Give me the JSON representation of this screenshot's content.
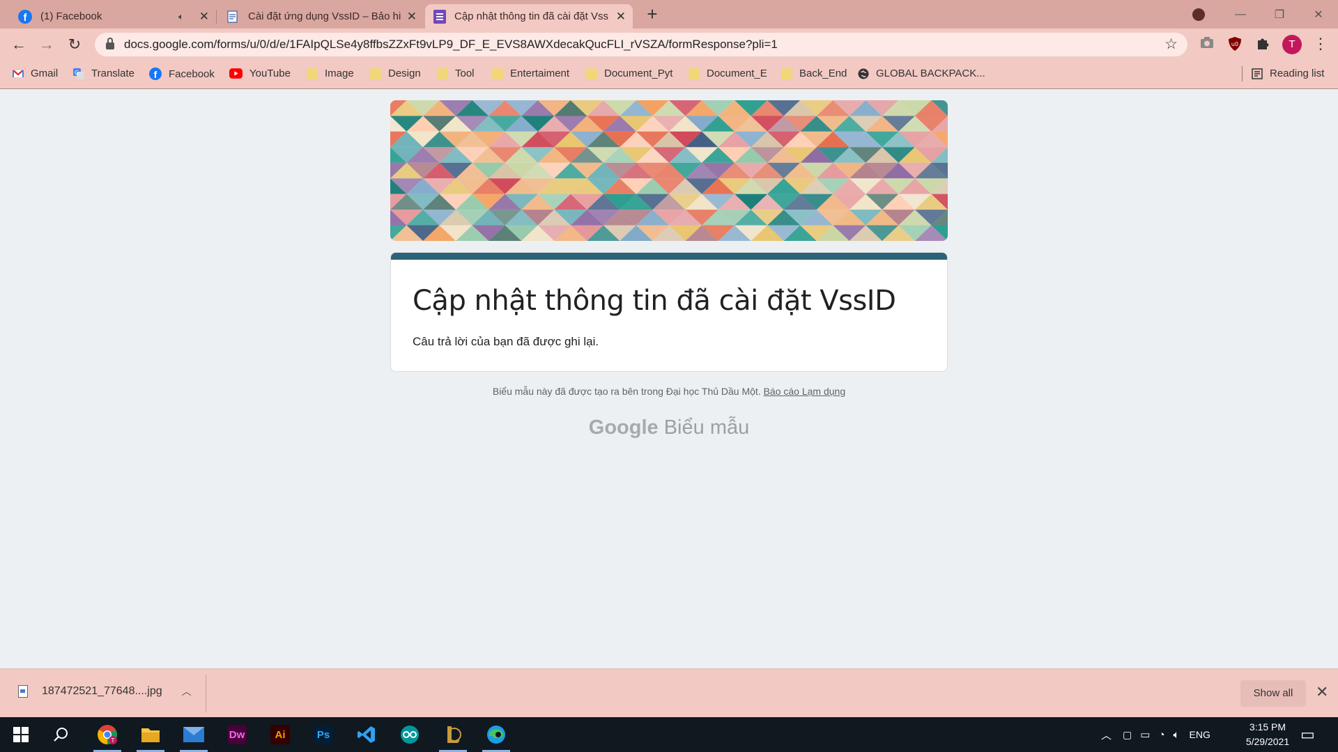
{
  "tabs": [
    {
      "title": "(1) Facebook",
      "icon": "facebook-icon",
      "muted": true
    },
    {
      "title": "Cài đặt ứng dụng VssID – Bảo hiể",
      "icon": "document-icon"
    },
    {
      "title": "Cập nhật thông tin đã cài đặt Vss",
      "icon": "google-forms-icon",
      "active": true
    }
  ],
  "toolbar": {
    "url": "docs.google.com/forms/u/0/d/e/1FAIpQLSe4y8ffbsZZxFt9vLP9_DF_E_EVS8AWXdecakQucFLI_rVSZA/formResponse?pli=1",
    "profile_initial": "T"
  },
  "bookmarks": [
    {
      "label": "Gmail",
      "icon": "gmail-icon"
    },
    {
      "label": "Translate",
      "icon": "translate-icon"
    },
    {
      "label": "Facebook",
      "icon": "facebook-icon"
    },
    {
      "label": "YouTube",
      "icon": "youtube-icon"
    },
    {
      "label": "Image",
      "icon": "folder-icon"
    },
    {
      "label": "Design",
      "icon": "folder-icon"
    },
    {
      "label": "Tool",
      "icon": "folder-icon"
    },
    {
      "label": "Entertaiment",
      "icon": "folder-icon"
    },
    {
      "label": "Document_Pyt",
      "icon": "folder-icon"
    },
    {
      "label": "Document_E",
      "icon": "folder-icon"
    },
    {
      "label": "Back_End",
      "icon": "folder-icon"
    },
    {
      "label": "GLOBAL BACKPACK...",
      "icon": "globe-icon"
    }
  ],
  "reading_list": "Reading list",
  "form": {
    "title": "Cập nhật thông tin đã cài đặt VssID",
    "message": "Câu trả lời của bạn đã được ghi lại.",
    "band_color": "#2c6377",
    "footer_text": "Biểu mẫu này đã được tạo ra bên trong Đại học Thủ Dầu Một.",
    "report_link": "Báo cáo Lạm dụng",
    "brand_google": "Google",
    "brand_forms": "Biểu mẫu"
  },
  "download": {
    "filename": "187472521_77648....jpg",
    "show_all": "Show all"
  },
  "taskbar": {
    "apps": [
      "start-icon",
      "search-icon",
      "chrome-icon",
      "file-explorer-icon",
      "mail-icon",
      "dreamweaver-icon",
      "illustrator-icon",
      "photoshop-icon",
      "vscode-icon",
      "arduino-icon",
      "league-icon",
      "edge-icon"
    ],
    "labels": {
      "dw": "Dw",
      "ai": "Ai",
      "ps": "Ps"
    },
    "language": "ENG",
    "time": "3:15 PM",
    "date": "5/29/2021"
  }
}
